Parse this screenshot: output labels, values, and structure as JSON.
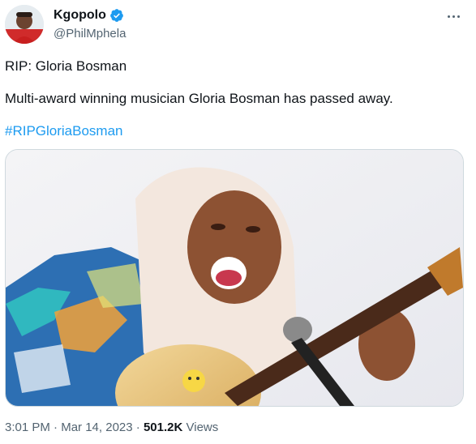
{
  "author": {
    "display_name": "Kgopolo",
    "handle": "@PhilMphela",
    "verified": true,
    "avatar_icon": "profile-avatar"
  },
  "more_icon": "more-horizontal-icon",
  "tweet": {
    "line1": "RIP: Gloria Bosman",
    "line2": "Multi-award winning musician Gloria Bosman has passed away.",
    "hashtag": "#RIPGloriaBosman"
  },
  "media": {
    "kind": "photo",
    "description_icon": "guitar-singer-photo"
  },
  "meta": {
    "time": "3:01 PM",
    "separator": " · ",
    "date": "Mar 14, 2023",
    "views_count": "501.2K",
    "views_label": "Views"
  },
  "colors": {
    "accent": "#1d9bf0",
    "secondary_text": "#536471",
    "primary_text": "#0f1419",
    "border": "#cfd9de"
  }
}
